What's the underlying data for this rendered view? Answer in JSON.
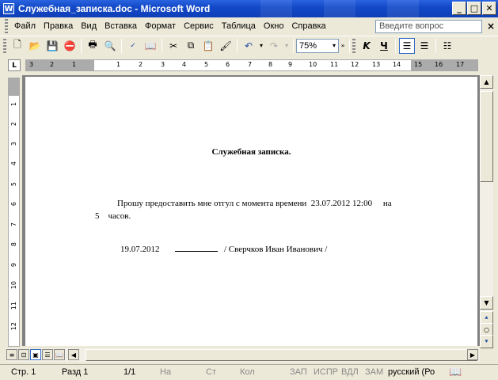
{
  "window": {
    "title": "Служебная_записка.doc - Microsoft Word",
    "app_icon": "W"
  },
  "menu": [
    {
      "label": "Файл"
    },
    {
      "label": "Правка"
    },
    {
      "label": "Вид"
    },
    {
      "label": "Вставка"
    },
    {
      "label": "Формат"
    },
    {
      "label": "Сервис"
    },
    {
      "label": "Таблица"
    },
    {
      "label": "Окно"
    },
    {
      "label": "Справка"
    }
  ],
  "help": {
    "placeholder": "Введите вопрос"
  },
  "toolbar": {
    "zoom": "75%",
    "bold": "K",
    "underline": "Ч"
  },
  "ruler": {
    "box_label": "L",
    "h_ticks": [
      "3",
      "2",
      "1",
      "1",
      "2",
      "3",
      "4",
      "5",
      "6",
      "7",
      "8",
      "9",
      "10",
      "11",
      "12",
      "13",
      "14",
      "15",
      "16",
      "17"
    ],
    "v_ticks": [
      "1",
      "2",
      "3",
      "4",
      "5",
      "6",
      "7",
      "8",
      "9",
      "10",
      "11",
      "12"
    ]
  },
  "document": {
    "title": "Служебная записка.",
    "line1": "Прошу предоставить мне отгул с момента времени  23.07.2012 12:00     на",
    "line2": "5    часов.",
    "date": "19.07.2012",
    "signature": "/ Сверчков Иван Иванович /"
  },
  "status": {
    "page": "Стр.  1",
    "section": "Разд  1",
    "pages": "1/1",
    "at": "На",
    "line": "Ст",
    "col": "Кол",
    "rec": "ЗАП",
    "trk": "ИСПР",
    "ext": "ВДЛ",
    "ovr": "ЗАМ",
    "lang": "русский (Ро"
  }
}
